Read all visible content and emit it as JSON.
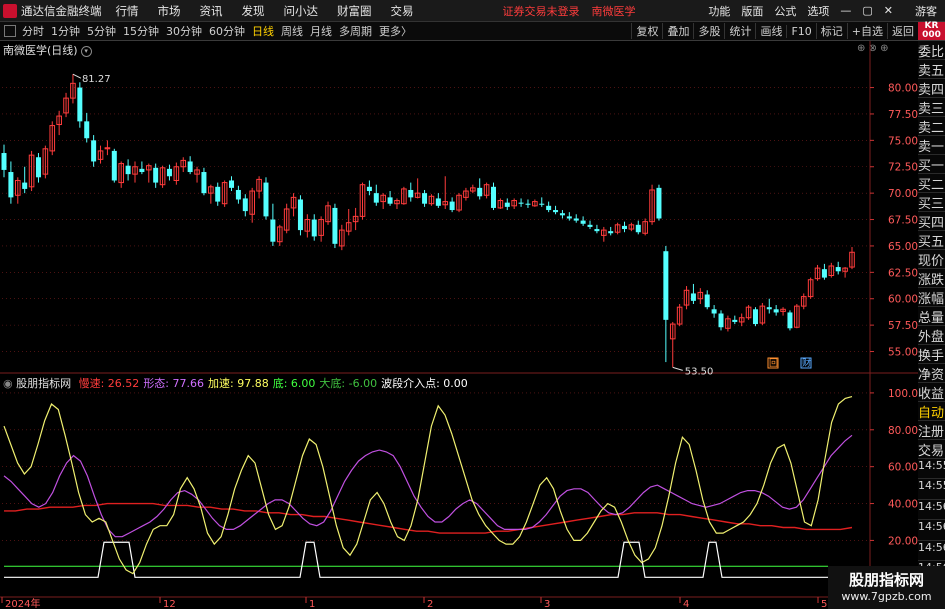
{
  "menubar": {
    "app_title": "通达信金融终端",
    "items": [
      "行情",
      "市场",
      "资讯",
      "发现",
      "问小达",
      "财富圈",
      "交易"
    ],
    "warning": "证券交易未登录",
    "stock_name": "南微医学",
    "right_items": [
      "功能",
      "版面",
      "公式",
      "选项"
    ],
    "window_controls": [
      "—",
      "▢",
      "✕"
    ],
    "guest": "游客"
  },
  "toolbar": {
    "periods": [
      "分时",
      "1分钟",
      "5分钟",
      "15分钟",
      "30分钟",
      "60分钟",
      "日线",
      "周线",
      "月线",
      "多周期",
      "更多"
    ],
    "active_period": "日线",
    "more_suffix": "〉",
    "right_buttons": [
      "复权",
      "叠加",
      "多股",
      "统计",
      "画线",
      "F10",
      "标记",
      "+自选",
      "返回"
    ]
  },
  "kr_label": "KR\n000",
  "chart_title": "南微医学(日线)",
  "panel_icons": "⊕ ⊗ ⊕",
  "price_axis": [
    "80.00",
    "77.50",
    "75.00",
    "72.50",
    "70.00",
    "67.50",
    "65.00",
    "62.50",
    "60.00",
    "57.50",
    "55.00"
  ],
  "high_marker": "81.27",
  "low_marker": "53.50",
  "event_badges": [
    "回",
    "财"
  ],
  "indicator": {
    "name": "股朋指标网",
    "fields": [
      {
        "label": "慢速:",
        "value": "26.52",
        "color": "#ff3c3c"
      },
      {
        "label": "形态:",
        "value": "77.66",
        "color": "#d070ff"
      },
      {
        "label": "加速:",
        "value": "97.88",
        "color": "#ffff60"
      },
      {
        "label": "底:",
        "value": "6.00",
        "color": "#40ff40"
      },
      {
        "label": "大底:",
        "value": "-6.00",
        "color": "#40c040"
      },
      {
        "label": "波段介入点:",
        "value": "0.00",
        "color": "#ffffff"
      }
    ],
    "axis": [
      "100.0",
      "80.00",
      "60.00",
      "40.00",
      "20.00"
    ]
  },
  "date_axis": [
    "2024年",
    "12",
    "1",
    "2",
    "3",
    "4",
    "5"
  ],
  "side_panel": [
    "委比",
    "卖五",
    "卖四",
    "卖三",
    "卖二",
    "卖一",
    "买一",
    "买二",
    "买三",
    "买四",
    "买五",
    "现价",
    "涨跌",
    "涨幅",
    "总量",
    "外盘",
    "换手",
    "净资",
    "收益",
    "自动",
    "注册",
    "交易",
    "14:55",
    "14:55",
    "14:56",
    "14:56",
    "14:56",
    "14:56",
    "14:56"
  ],
  "watermark": {
    "line1": "股朋指标网",
    "line2": "www.7gpzb.com"
  },
  "colors": {
    "up": "#ff3c3c",
    "down": "#54ffff",
    "grid": "#7a1e1e"
  },
  "chart_data": {
    "type": "candlestick",
    "ylim": [
      53.0,
      83.0
    ],
    "ohlc": [
      [
        73.8,
        74.6,
        71.5,
        72.2
      ],
      [
        72.0,
        73.0,
        69.0,
        69.6
      ],
      [
        69.8,
        71.5,
        69.0,
        71.2
      ],
      [
        71.0,
        72.5,
        70.0,
        70.4
      ],
      [
        70.6,
        74.0,
        70.2,
        73.6
      ],
      [
        73.4,
        73.8,
        71.0,
        71.5
      ],
      [
        71.8,
        74.5,
        71.4,
        74.2
      ],
      [
        74.0,
        76.8,
        73.6,
        76.4
      ],
      [
        76.5,
        77.8,
        75.5,
        77.3
      ],
      [
        77.6,
        79.5,
        77.2,
        79.0
      ],
      [
        79.0,
        81.27,
        78.5,
        80.4
      ],
      [
        80.0,
        80.5,
        76.2,
        76.8
      ],
      [
        76.8,
        77.6,
        74.8,
        75.2
      ],
      [
        75.0,
        75.5,
        72.5,
        73.0
      ],
      [
        73.2,
        74.5,
        72.8,
        74.0
      ],
      [
        74.2,
        75.0,
        73.6,
        74.3
      ],
      [
        74.0,
        74.2,
        71.0,
        71.2
      ],
      [
        71.0,
        73.0,
        70.5,
        72.8
      ],
      [
        72.6,
        73.2,
        71.2,
        71.8
      ],
      [
        71.8,
        73.0,
        71.0,
        72.5
      ],
      [
        72.3,
        73.0,
        71.8,
        72.0
      ],
      [
        72.2,
        72.8,
        71.0,
        72.6
      ],
      [
        72.4,
        72.8,
        70.5,
        71.0
      ],
      [
        70.8,
        72.6,
        70.5,
        72.4
      ],
      [
        72.3,
        72.7,
        71.2,
        71.6
      ],
      [
        71.2,
        72.9,
        70.8,
        72.5
      ],
      [
        72.5,
        73.4,
        72.0,
        73.1
      ],
      [
        73.0,
        73.5,
        71.8,
        72.0
      ],
      [
        71.8,
        72.5,
        71.0,
        72.2
      ],
      [
        72.0,
        72.4,
        69.8,
        70.0
      ],
      [
        70.0,
        70.8,
        69.0,
        70.6
      ],
      [
        70.6,
        71.0,
        68.8,
        69.2
      ],
      [
        69.0,
        71.2,
        68.7,
        71.0
      ],
      [
        71.2,
        71.6,
        70.2,
        70.5
      ],
      [
        70.3,
        70.7,
        69.0,
        69.4
      ],
      [
        69.5,
        69.9,
        67.8,
        68.3
      ],
      [
        68.0,
        70.5,
        67.2,
        70.2
      ],
      [
        70.2,
        71.6,
        69.5,
        71.3
      ],
      [
        71.0,
        71.5,
        67.5,
        67.8
      ],
      [
        67.5,
        69.0,
        65.0,
        65.4
      ],
      [
        65.4,
        67.0,
        65.0,
        66.8
      ],
      [
        66.5,
        69.0,
        66.2,
        68.5
      ],
      [
        68.6,
        70.0,
        67.8,
        69.6
      ],
      [
        69.4,
        69.8,
        66.0,
        66.5
      ],
      [
        66.4,
        68.0,
        65.8,
        67.5
      ],
      [
        67.5,
        68.0,
        65.5,
        65.9
      ],
      [
        66.0,
        67.8,
        65.4,
        67.5
      ],
      [
        67.3,
        69.2,
        67.0,
        68.8
      ],
      [
        68.6,
        69.0,
        64.8,
        65.2
      ],
      [
        65.0,
        67.0,
        64.6,
        66.5
      ],
      [
        66.4,
        68.5,
        66.0,
        67.2
      ],
      [
        67.3,
        68.6,
        66.5,
        67.8
      ],
      [
        67.8,
        71.0,
        67.5,
        70.8
      ],
      [
        70.6,
        71.2,
        69.8,
        70.2
      ],
      [
        70.0,
        70.8,
        68.8,
        69.1
      ],
      [
        69.2,
        70.0,
        68.5,
        69.8
      ],
      [
        69.6,
        70.2,
        68.8,
        69.0
      ],
      [
        69.0,
        69.5,
        68.5,
        69.3
      ],
      [
        69.0,
        70.6,
        68.9,
        70.4
      ],
      [
        70.3,
        71.0,
        69.2,
        69.6
      ],
      [
        69.6,
        71.4,
        69.5,
        70.0
      ],
      [
        70.0,
        70.3,
        68.7,
        69.0
      ],
      [
        69.0,
        69.9,
        68.8,
        69.7
      ],
      [
        69.5,
        70.0,
        68.6,
        68.8
      ],
      [
        68.9,
        71.6,
        68.5,
        69.2
      ],
      [
        69.2,
        69.6,
        68.2,
        68.4
      ],
      [
        68.4,
        70.0,
        68.2,
        69.8
      ],
      [
        69.6,
        70.5,
        69.3,
        70.2
      ],
      [
        70.2,
        70.8,
        70.0,
        70.5
      ],
      [
        70.5,
        71.4,
        69.4,
        69.7
      ],
      [
        69.8,
        71.0,
        69.5,
        70.8
      ],
      [
        70.6,
        71.0,
        68.4,
        68.6
      ],
      [
        68.6,
        69.5,
        68.5,
        69.3
      ],
      [
        69.1,
        69.5,
        68.4,
        68.7
      ],
      [
        68.8,
        69.5,
        68.5,
        69.3
      ],
      [
        69.1,
        69.5,
        68.7,
        69.0
      ],
      [
        69.0,
        69.4,
        68.6,
        68.9
      ],
      [
        68.8,
        69.4,
        68.7,
        69.2
      ],
      [
        69.0,
        69.6,
        68.7,
        68.9
      ],
      [
        68.8,
        69.2,
        68.2,
        68.4
      ],
      [
        68.4,
        68.8,
        68.0,
        68.2
      ],
      [
        68.1,
        68.4,
        67.6,
        67.9
      ],
      [
        67.8,
        68.2,
        67.4,
        67.6
      ],
      [
        67.6,
        68.0,
        67.2,
        67.4
      ],
      [
        67.4,
        67.8,
        66.9,
        67.1
      ],
      [
        67.0,
        67.4,
        66.6,
        66.8
      ],
      [
        66.6,
        67.0,
        66.2,
        66.4
      ],
      [
        66.0,
        66.8,
        65.4,
        66.5
      ],
      [
        66.4,
        66.8,
        66.0,
        66.2
      ],
      [
        66.3,
        67.2,
        66.1,
        67.0
      ],
      [
        66.9,
        67.3,
        66.3,
        66.6
      ],
      [
        66.6,
        67.2,
        66.4,
        67.0
      ],
      [
        67.0,
        67.4,
        66.1,
        66.3
      ],
      [
        66.2,
        67.6,
        66.0,
        67.3
      ],
      [
        67.3,
        70.8,
        67.0,
        70.3
      ],
      [
        70.5,
        70.8,
        67.4,
        67.6
      ],
      [
        64.5,
        65.0,
        54.0,
        58.0
      ],
      [
        56.2,
        57.8,
        53.5,
        57.6
      ],
      [
        57.6,
        59.5,
        57.4,
        59.2
      ],
      [
        59.4,
        61.2,
        59.0,
        60.8
      ],
      [
        60.5,
        61.4,
        59.5,
        59.8
      ],
      [
        60.0,
        61.0,
        59.5,
        60.6
      ],
      [
        60.4,
        60.8,
        59.0,
        59.2
      ],
      [
        59.0,
        59.4,
        58.2,
        58.6
      ],
      [
        58.6,
        58.9,
        57.0,
        57.3
      ],
      [
        57.2,
        58.4,
        56.9,
        58.1
      ],
      [
        58.0,
        58.4,
        57.6,
        57.8
      ],
      [
        57.8,
        58.6,
        57.4,
        58.2
      ],
      [
        58.2,
        59.4,
        58.0,
        59.2
      ],
      [
        59.0,
        59.2,
        57.4,
        57.6
      ],
      [
        57.7,
        59.6,
        57.5,
        59.3
      ],
      [
        59.2,
        60.0,
        58.6,
        59.0
      ],
      [
        59.0,
        59.4,
        58.4,
        58.7
      ],
      [
        58.8,
        59.2,
        58.4,
        59.0
      ],
      [
        58.7,
        58.9,
        57.0,
        57.2
      ],
      [
        57.3,
        59.5,
        57.2,
        59.3
      ],
      [
        59.3,
        60.5,
        59.0,
        60.2
      ],
      [
        60.2,
        62.0,
        60.0,
        61.8
      ],
      [
        61.9,
        63.2,
        61.7,
        62.9
      ],
      [
        62.8,
        63.3,
        61.8,
        62.0
      ],
      [
        62.2,
        63.4,
        62.0,
        63.1
      ],
      [
        63.0,
        63.5,
        62.3,
        62.6
      ],
      [
        62.6,
        63.0,
        62.0,
        62.9
      ],
      [
        63.0,
        64.9,
        62.8,
        64.4
      ]
    ],
    "indicator_series": {
      "ylim": [
        0,
        105
      ],
      "slow_red": [
        36,
        36,
        37,
        37,
        38,
        38,
        38,
        39,
        39,
        40,
        40,
        40,
        40,
        40,
        39,
        39,
        39,
        38,
        38,
        37,
        37,
        36,
        36,
        35,
        35,
        34,
        34,
        33,
        33,
        32,
        31,
        30,
        29,
        28,
        27,
        26,
        25,
        25,
        24,
        24,
        24,
        24,
        24,
        25,
        25,
        26,
        27,
        28,
        29,
        30,
        31,
        32,
        33,
        34,
        34,
        35,
        35,
        35,
        34,
        34,
        33,
        32,
        31,
        30,
        29,
        29,
        28,
        28,
        27,
        27,
        26,
        26,
        26,
        26,
        27
      ],
      "form_purple": [
        55,
        52,
        48,
        44,
        40,
        38,
        40,
        46,
        55,
        62,
        66,
        63,
        55,
        44,
        34,
        26,
        22,
        22,
        24,
        26,
        28,
        30,
        33,
        37,
        42,
        46,
        47,
        45,
        42,
        37,
        32,
        28,
        26,
        26,
        28,
        31,
        34,
        37,
        40,
        42,
        42,
        40,
        36,
        32,
        29,
        28,
        30,
        36,
        44,
        52,
        58,
        63,
        66,
        68,
        69,
        68,
        66,
        60,
        52,
        44,
        38,
        33,
        30,
        30,
        33,
        37,
        40,
        42,
        40,
        36,
        32,
        28,
        26,
        26,
        26,
        26,
        27,
        30,
        34,
        39,
        44,
        47,
        48,
        48,
        46,
        42,
        38,
        35,
        34,
        35,
        38,
        42,
        46,
        49,
        50,
        48,
        46,
        44,
        42,
        40,
        39,
        38,
        39,
        40,
        42,
        44,
        46,
        47,
        47,
        46,
        44,
        41,
        38,
        37,
        38,
        42,
        48,
        54,
        60,
        66,
        70,
        74,
        77
      ],
      "accel_yellow": [
        82,
        72,
        62,
        56,
        60,
        72,
        85,
        94,
        91,
        77,
        62,
        46,
        34,
        30,
        32,
        30,
        20,
        10,
        4,
        2,
        8,
        18,
        26,
        28,
        28,
        34,
        48,
        54,
        48,
        38,
        24,
        18,
        22,
        34,
        48,
        58,
        66,
        62,
        48,
        34,
        26,
        28,
        38,
        52,
        66,
        75,
        72,
        60,
        44,
        28,
        16,
        12,
        18,
        30,
        42,
        46,
        40,
        30,
        22,
        20,
        28,
        42,
        62,
        82,
        93,
        88,
        78,
        66,
        54,
        42,
        34,
        28,
        24,
        20,
        18,
        18,
        22,
        30,
        40,
        50,
        54,
        48,
        36,
        26,
        20,
        20,
        24,
        30,
        36,
        40,
        38,
        30,
        20,
        12,
        8,
        10,
        16,
        28,
        44,
        62,
        76,
        72,
        58,
        42,
        30,
        24,
        24,
        26,
        28,
        30,
        34,
        40,
        50,
        62,
        70,
        72,
        62,
        46,
        30,
        28,
        42,
        64,
        84,
        94,
        97,
        98
      ]
    }
  }
}
